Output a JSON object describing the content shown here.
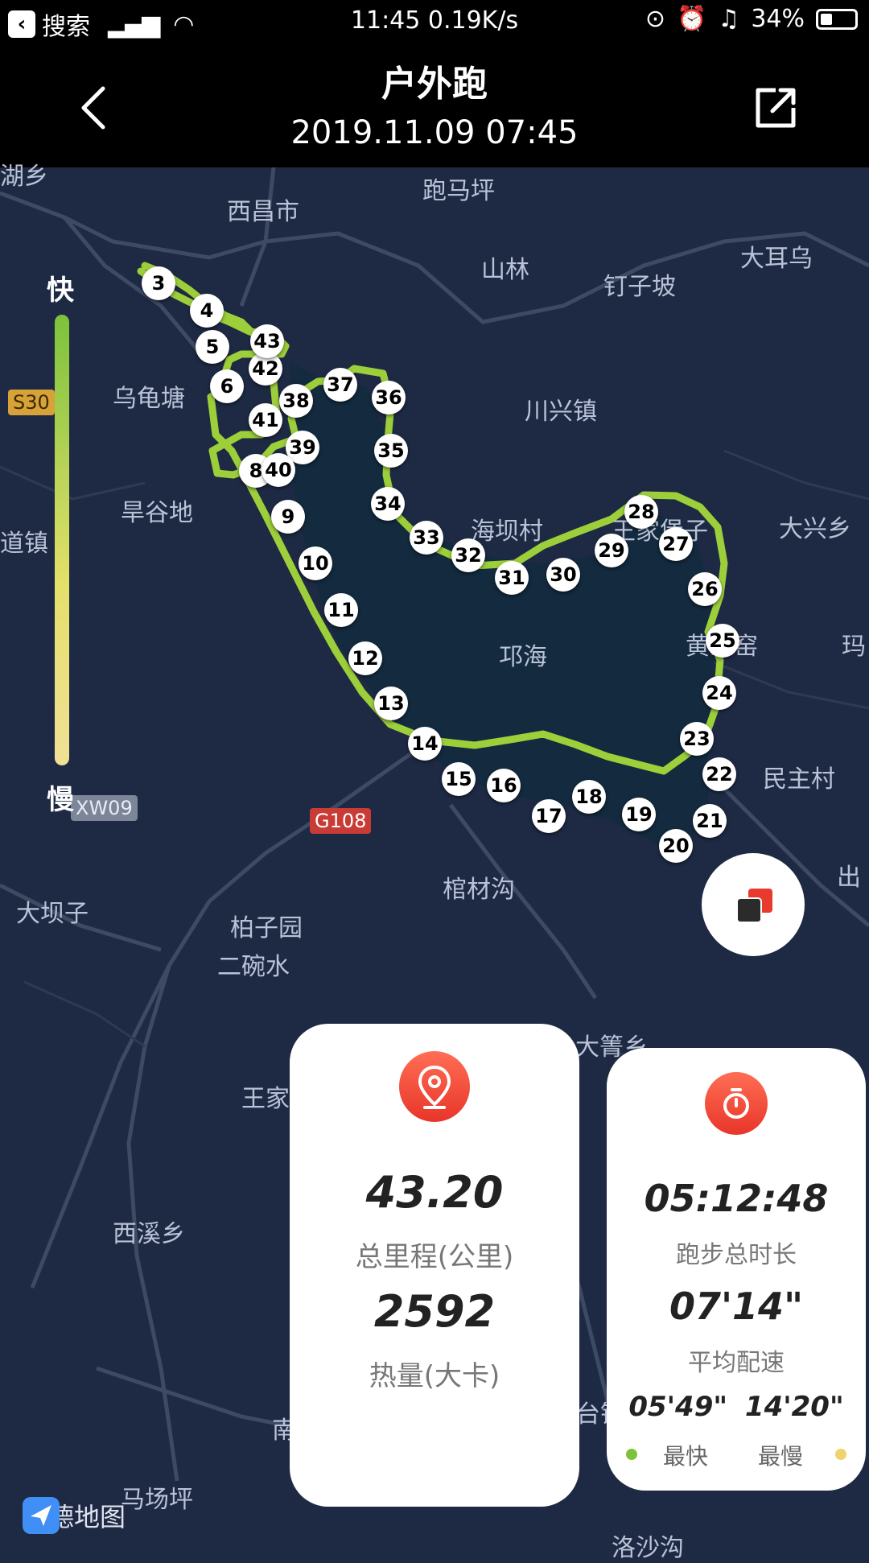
{
  "status_bar": {
    "back_app": "搜索",
    "time_speed": "11:45 0.19K/s",
    "battery_text": "34%",
    "battery_level": 0.34
  },
  "header": {
    "title": "户外跑",
    "datetime": "2019.11.09 07:45"
  },
  "speed_legend": {
    "fast": "快",
    "slow": "慢"
  },
  "map": {
    "places": [
      "跑马坪",
      "西昌市",
      "山林",
      "钉子坡",
      "大耳乌",
      "乌龟塘",
      "川兴镇",
      "旱谷地",
      "海坝村",
      "王家堡子",
      "大兴乡",
      "道镇",
      "邛海",
      "黄家窑",
      "玛",
      "民主村",
      "棺材沟",
      "出",
      "大坝子",
      "柏子园",
      "二碗水",
      "大箐乡",
      "王家",
      "西溪乡",
      "南",
      "台镇",
      "马场坪",
      "洛沙沟",
      "湖乡"
    ],
    "roads": [
      "S30",
      "XW09",
      "G108"
    ],
    "km_markers": [
      "3",
      "4",
      "5",
      "6",
      "8",
      "9",
      "10",
      "11",
      "12",
      "13",
      "14",
      "15",
      "16",
      "17",
      "18",
      "19",
      "20",
      "21",
      "22",
      "23",
      "24",
      "25",
      "26",
      "27",
      "28",
      "29",
      "30",
      "31",
      "32",
      "33",
      "34",
      "35",
      "36",
      "37",
      "38",
      "39",
      "40",
      "41",
      "42",
      "43"
    ]
  },
  "distance_card": {
    "distance": "43.20",
    "distance_label": "总里程(公里)",
    "calories": "2592",
    "calories_label": "热量(大卡)"
  },
  "time_card": {
    "duration": "05:12:48",
    "duration_label": "跑步总时长",
    "avg_pace": "07'14\"",
    "avg_pace_label": "平均配速",
    "fastest_pace": "05'49\"",
    "slowest_pace": "14'20\"",
    "fastest_label": "最快",
    "slowest_label": "最慢"
  },
  "logo": {
    "text": "高德地图"
  },
  "colors": {
    "route": "#9ccf3a",
    "accent": "#ee3b2e",
    "lake": "#132a3f",
    "map_bg": "#1e2a44"
  }
}
